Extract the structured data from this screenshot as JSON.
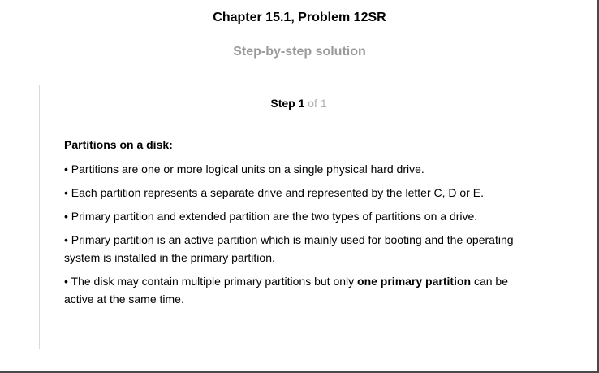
{
  "header": {
    "chapter_title": "Chapter 15.1, Problem 12SR",
    "subtitle": "Step-by-step solution"
  },
  "step": {
    "label": "Step 1",
    "count": "of 1"
  },
  "content": {
    "heading": "Partitions on a disk:",
    "bullets": [
      "• Partitions are one or more logical units on a single physical hard drive.",
      "• Each partition represents a separate drive and represented by the letter C, D or E.",
      "• Primary partition and extended partition are the two types of partitions on a drive.",
      "• Primary partition is an active partition which is mainly used for booting and the operating system is installed in the primary partition."
    ],
    "last_bullet": {
      "before": "• The disk may contain multiple primary partitions but only ",
      "emphasis": "one primary partition",
      "after": " can be active at the same time."
    }
  }
}
